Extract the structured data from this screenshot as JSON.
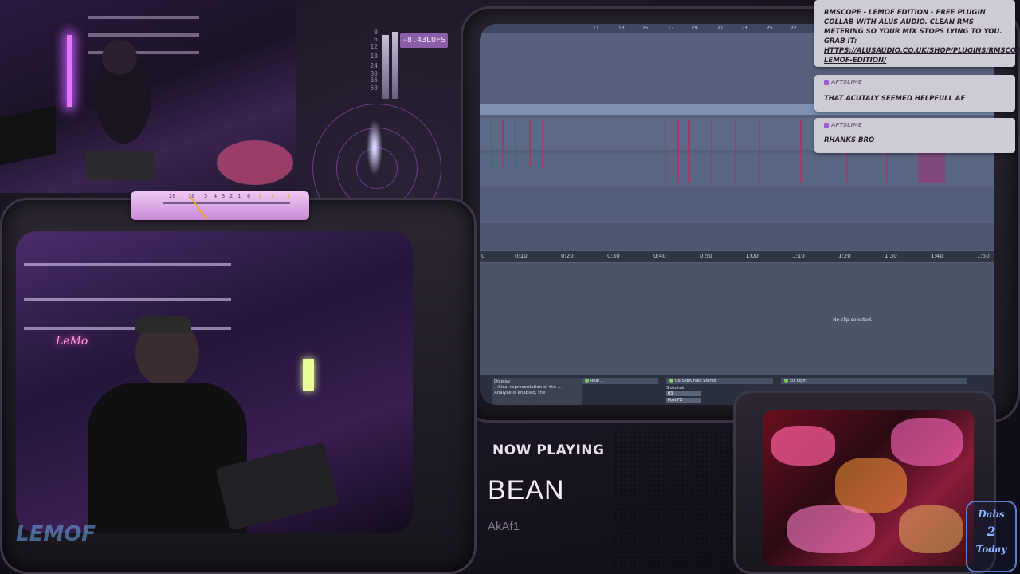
{
  "meter": {
    "lufs": "-8.43LUFS",
    "ticks": [
      "0",
      "6",
      "12",
      "18",
      "24",
      "30",
      "36",
      "50"
    ]
  },
  "vu": {
    "ticks": [
      "20",
      "10",
      "5",
      "4",
      "3",
      "2",
      "1",
      "0",
      "1",
      "2",
      "3"
    ]
  },
  "daw": {
    "ruler_top": [
      "11",
      "13",
      "15",
      "17",
      "19",
      "21",
      "23",
      "25",
      "27"
    ],
    "timeline": [
      "0",
      "0:10",
      "0:20",
      "0:30",
      "0:40",
      "0:50",
      "1:00",
      "1:10",
      "1:20",
      "1:30",
      "1:40",
      "1:50"
    ],
    "no_clip": "No clip selected.",
    "info_title": "Display",
    "info_text": "...hical representation of the ... Analyze is enabled, the",
    "devices": [
      {
        "name": "Real ..."
      },
      {
        "name": "C6-SideChain Stereo"
      },
      {
        "name": "EQ Eight"
      }
    ],
    "sidechain_label": "Sidechain",
    "sidechain_value": "03",
    "post_fx": "Post FX"
  },
  "chat": {
    "messages": [
      {
        "user": "",
        "text": "RMSCOPE - LEMOF EDITION - FREE PLUGIN COLLAB WITH ALUS AUDIO. CLEAN RMS METERING SO YOUR MIX STOPS LYING TO YOU. GRAB IT:",
        "link": "HTTPS://ALUSAUDIO.CO.UK/SHOP/PLUGINS/RMSCOPE-LEMOF-EDITION/"
      },
      {
        "user": "AFTSLIME",
        "text": "THAT ACUTALY SEEMED HELPFULL AF"
      },
      {
        "user": "AFTSLIME",
        "text": "RHANKS BRO"
      }
    ]
  },
  "now_playing": {
    "label": "NOW PLAYING",
    "title": "BEAN",
    "artist": "AkAf1"
  },
  "logo": {
    "line1": "Dabs",
    "line2": "2",
    "line3": "Today"
  },
  "colors": {
    "accent": "#c45cff",
    "daw_bg": "#56607a",
    "chat_bg": "#cfcbd6"
  }
}
